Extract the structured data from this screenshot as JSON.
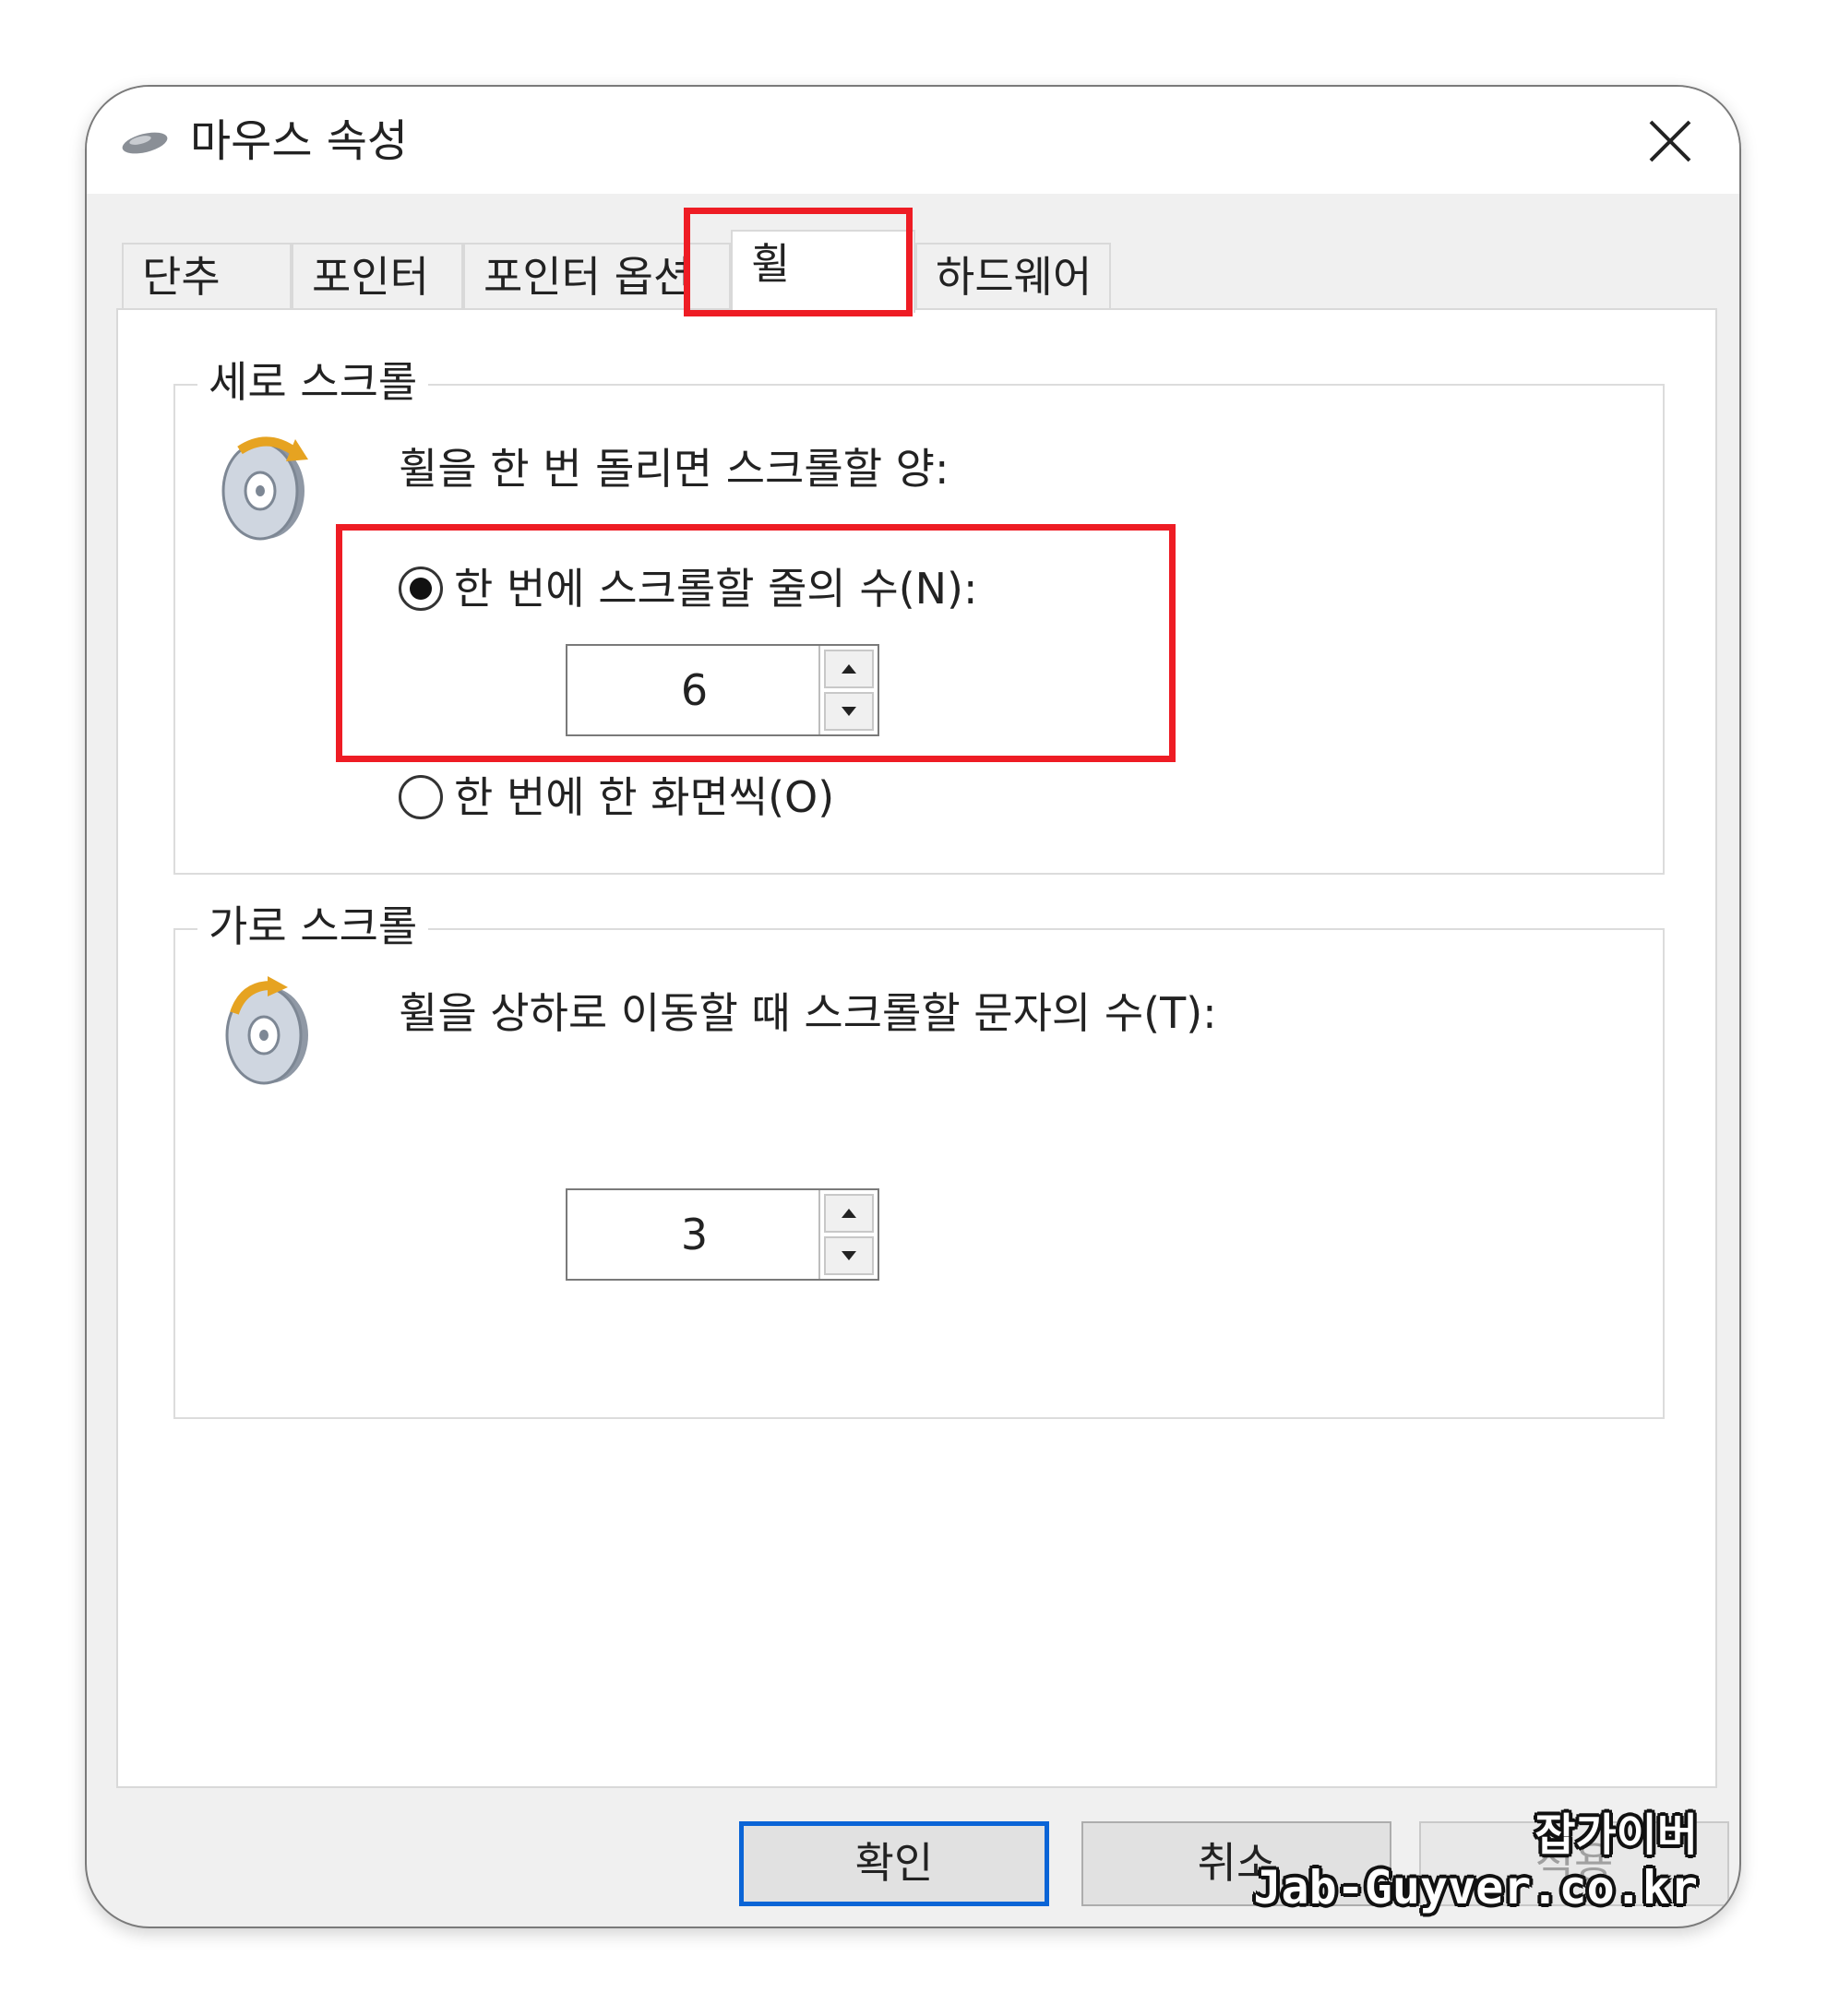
{
  "window": {
    "title": "마우스 속성",
    "icon": "mouse-icon",
    "close_icon": "close-icon"
  },
  "tabs": [
    {
      "label": "단추",
      "active": false
    },
    {
      "label": "포인터",
      "active": false
    },
    {
      "label": "포인터 옵션",
      "active": false
    },
    {
      "label": "휠",
      "active": true
    },
    {
      "label": "하드웨어",
      "active": false
    }
  ],
  "vertical_scroll": {
    "title": "세로 스크롤",
    "icon": "vertical-wheel-icon",
    "prompt": "휠을 한 번 돌리면 스크롤할 양:",
    "option_lines": {
      "label": "한 번에 스크롤할 줄의 수(N):",
      "selected": true
    },
    "lines_value": "6",
    "option_screen": {
      "label": "한 번에 한 화면씩(O)",
      "selected": false
    }
  },
  "horizontal_scroll": {
    "title": "가로 스크롤",
    "icon": "horizontal-wheel-icon",
    "prompt": "휠을 상하로 이동할 때 스크롤할 문자의 수(T):",
    "chars_value": "3"
  },
  "buttons": {
    "ok": "확인",
    "cancel": "취소",
    "apply": "적용"
  },
  "watermark": {
    "line1": "잡가이버",
    "line2": "Jab-Guyver.co.kr"
  },
  "colors": {
    "highlight": "#ee1c24",
    "primary_button_border": "#0a64d6"
  }
}
